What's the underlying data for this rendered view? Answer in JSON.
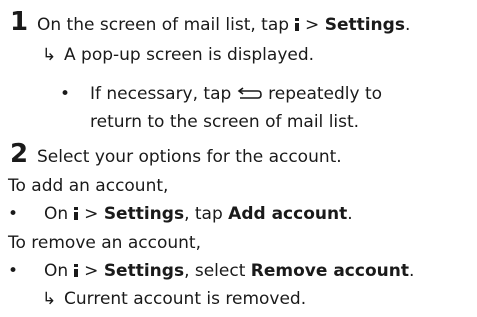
{
  "step1": {
    "number": "1",
    "text_pre": "On the screen of mail list, tap",
    "text_gt": ">",
    "settings": "Settings",
    "dot": ".",
    "arrow_glyph": "↳",
    "result": "A pop-up screen is displayed.",
    "bullet_glyph": "•",
    "note_line1_pre": "If necessary, tap",
    "note_line1_post": "repeatedly to",
    "note_line2": "return to the screen of mail list."
  },
  "step2": {
    "number": "2",
    "text": "Select your options for the account."
  },
  "add": {
    "heading": "To add an account,",
    "bullet_glyph": "•",
    "on": "On",
    "gt": ">",
    "settings": "Settings",
    "tap": ", tap",
    "action": "Add account",
    "dot": "."
  },
  "remove": {
    "heading": "To remove an account,",
    "bullet_glyph": "•",
    "on": "On",
    "gt": ">",
    "settings": "Settings",
    "select": ", select",
    "action": "Remove account",
    "dot": ".",
    "arrow_glyph": "↳",
    "result": "Current account is removed."
  },
  "icons": {
    "menu": "menu-icon",
    "back": "back-arrow-icon"
  }
}
